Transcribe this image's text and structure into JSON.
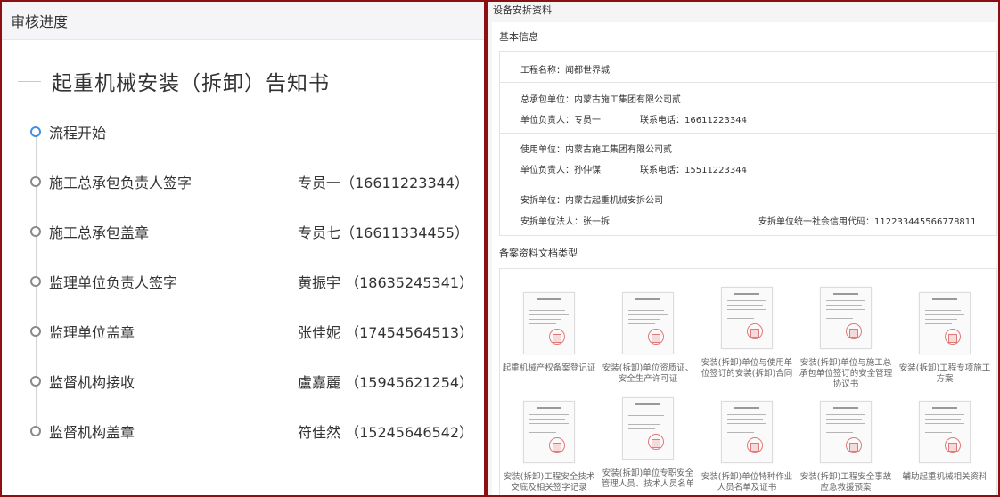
{
  "left": {
    "header": "审核进度",
    "doc_title": "起重机械安装（拆卸）告知书",
    "steps": [
      {
        "label": "流程开始",
        "person": ""
      },
      {
        "label": "施工总承包负责人签字",
        "person": "专员一（16611223344）"
      },
      {
        "label": "施工总承包盖章",
        "person": "专员七（16611334455）"
      },
      {
        "label": "监理单位负责人签字",
        "person": "黄振宇 （18635245341）"
      },
      {
        "label": "监理单位盖章",
        "person": "张佳妮 （17454564513）"
      },
      {
        "label": "监督机构接收",
        "person": "盧嘉麗 （15945621254）"
      },
      {
        "label": "监督机构盖章",
        "person": "符佳然 （15245646542）"
      }
    ]
  },
  "right": {
    "title": "设备安拆资料",
    "basic_title": "基本信息",
    "project": "工程名称：闻都世界城",
    "general_contractor": "总承包单位：内蒙古施工集团有限公司贰",
    "gc_person": "单位负责人：专员一",
    "gc_phone": "联系电话：16611223344",
    "user_unit": "使用单位：内蒙古施工集团有限公司贰",
    "user_person": "单位负责人：孙仲谋",
    "user_phone": "联系电话：15511223344",
    "install_unit": "安拆单位：内蒙古起重机械安拆公司",
    "install_person": "安拆单位法人：张一拆",
    "install_credit": "安拆单位统一社会信用代码：112233445566778811",
    "docs_title": "备案资料文档类型",
    "docs": [
      "起重机械产权备案登记证",
      "安装(拆卸)单位资质证、安全生产许可证",
      "安装(拆卸)单位与使用单位签订的安装(拆卸)合同",
      "安装(拆卸)单位与施工总承包单位签订的安全管理协议书",
      "安装(拆卸)工程专项施工方案",
      "安装(拆卸)工程安全技术交底及相关签字记录",
      "安装(拆卸)单位专职安全管理人员、技术人员名单",
      "安装(拆卸)单位特种作业人员名单及证书",
      "安装(拆卸)工程安全事故应急救援预案",
      "辅助起重机械相关资料"
    ]
  },
  "colors": {
    "frame": "#8e0f12",
    "active_dot": "#3f93e6",
    "inactive_dot": "#8a8a8a"
  }
}
